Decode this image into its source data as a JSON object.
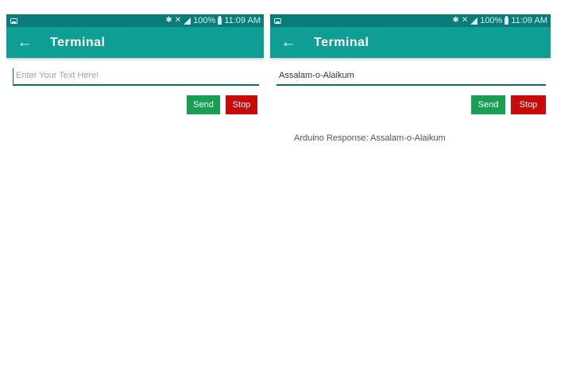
{
  "screens": [
    {
      "status": {
        "time": "11:09 AM",
        "battery": "100%"
      },
      "app_title": "Terminal",
      "input": {
        "value": "",
        "placeholder": "Enter Your Text Here!"
      },
      "send_label": "Send",
      "stop_label": "Stop",
      "response": ""
    },
    {
      "status": {
        "time": "11:09 AM",
        "battery": "100%"
      },
      "app_title": "Terminal",
      "input": {
        "value": "Assalam-o-Alaikum",
        "placeholder": "Enter Your Text Here!"
      },
      "send_label": "Send",
      "stop_label": "Stop",
      "response": "Arduino Response: Assalam-o-Alaikum"
    }
  ],
  "icons": {
    "back": "arrow-left",
    "bluetooth": "bluetooth",
    "mute": "vibrate-off",
    "signal": "cell-signal",
    "battery": "battery",
    "notification": "image"
  },
  "colors": {
    "status_bar": "#0a7c78",
    "app_bar": "#0e9e96",
    "input_underline": "#0b6e6a",
    "send_button": "#17a053",
    "stop_button": "#c80a0a"
  }
}
